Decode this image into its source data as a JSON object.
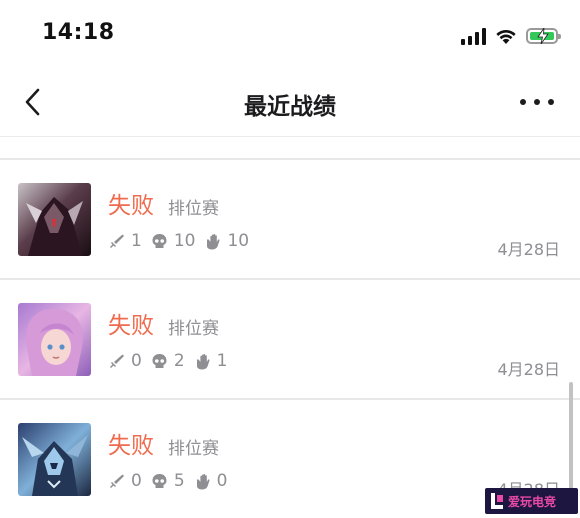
{
  "status_bar": {
    "time": "14:18",
    "icons": [
      "signal-icon",
      "wifi-icon",
      "battery-charging-icon"
    ],
    "battery_color": "#34c759"
  },
  "nav": {
    "title": "最近战绩",
    "back_icon": "chevron-left-icon",
    "more_icon": "more-dots-icon"
  },
  "matches": [
    {
      "result": "失败",
      "mode": "排位赛",
      "kills": "1",
      "deaths": "10",
      "assists": "10",
      "date": "4月28日",
      "avatar": "hero-avatar-dark-armor"
    },
    {
      "result": "失败",
      "mode": "排位赛",
      "kills": "0",
      "deaths": "2",
      "assists": "1",
      "date": "4月28日",
      "avatar": "hero-avatar-pink-hair"
    },
    {
      "result": "失败",
      "mode": "排位赛",
      "kills": "0",
      "deaths": "5",
      "assists": "0",
      "date": "4月28日",
      "avatar": "hero-avatar-blue-mech"
    }
  ],
  "colors": {
    "result_loss": "#ee6b4d",
    "secondary_text": "#8e8e93"
  },
  "watermark": {
    "text": "爱玩电竞"
  }
}
